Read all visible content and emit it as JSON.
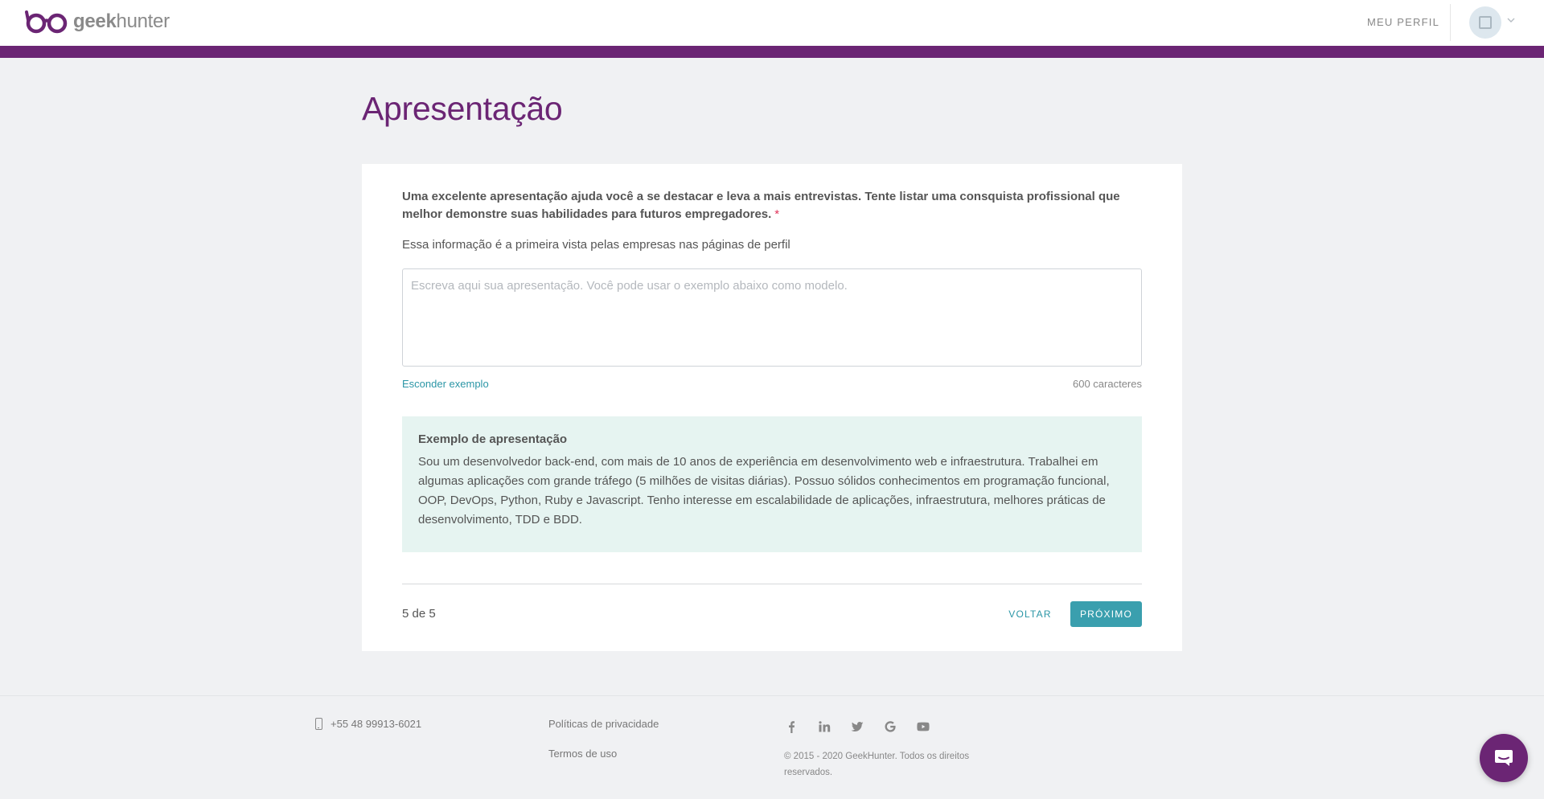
{
  "header": {
    "logo_bold": "geek",
    "logo_light": "hunter",
    "profile_link": "MEU PERFIL"
  },
  "main": {
    "title": "Apresentação",
    "intro": "Uma excelente apresentação ajuda você a se destacar e leva a mais entrevistas. Tente listar uma consquista profissional que melhor demonstre suas habilidades para futuros empregadores.",
    "required_mark": "*",
    "subtitle": "Essa informação é a primeira vista pelas empresas nas páginas de perfil",
    "textarea": {
      "value": "",
      "placeholder": "Escreva aqui sua apresentação. Você pode usar o exemplo abaixo como modelo."
    },
    "hide_example_link": "Esconder exemplo",
    "char_count": "600 caracteres",
    "example": {
      "title": "Exemplo de apresentação",
      "text": "Sou um desenvolvedor back-end, com mais de 10 anos de experiência em desenvolvimento web e infraestrutura. Trabalhei em algumas aplicações com grande tráfego (5 milhões de visitas diárias). Possuo sólidos conhecimentos em programação funcional, OOP, DevOps, Python, Ruby e Javascript. Tenho interesse em escalabilidade de aplicações, infraestrutura, melhores práticas de desenvolvimento, TDD e BDD."
    },
    "step": "5 de 5",
    "back_button": "VOLTAR",
    "next_button": "PRÓXIMO"
  },
  "footer": {
    "phone": "+55 48 99913-6021",
    "privacy_link": "Políticas de privacidade",
    "terms_link": "Termos de uso",
    "social_icons": [
      "facebook-icon",
      "linkedin-icon",
      "twitter-icon",
      "google-icon",
      "youtube-icon"
    ],
    "copyright": "© 2015 - 2020 GeekHunter. Todos os direitos reservados."
  },
  "colors": {
    "brand_purple": "#6b2574",
    "accent_teal": "#3a9fae",
    "link_teal": "#2b96a6",
    "example_bg": "#e6f4f1",
    "page_bg": "#f0f1f3"
  }
}
